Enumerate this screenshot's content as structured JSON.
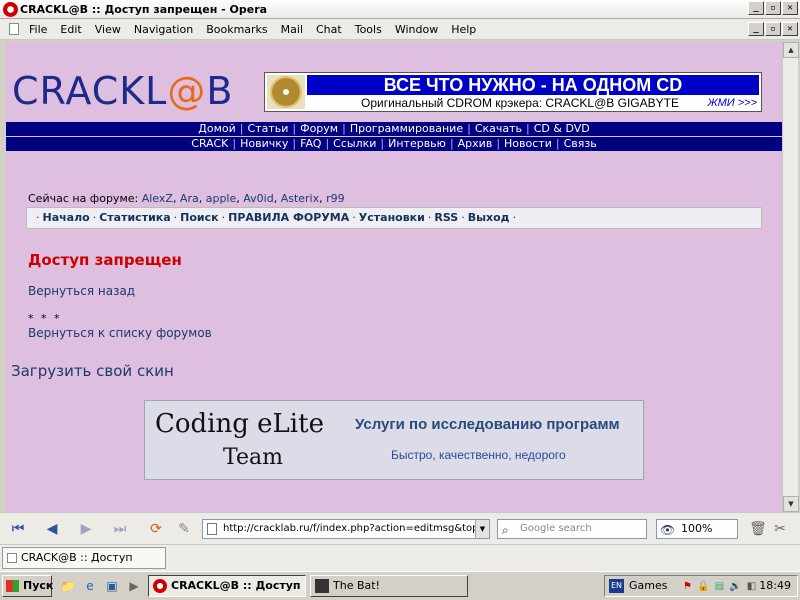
{
  "window": {
    "title": "CRACKL@B :: Доступ запрещен - Opera",
    "controls": [
      "_",
      "▫",
      "✕"
    ]
  },
  "menubar": {
    "items": [
      "File",
      "Edit",
      "View",
      "Navigation",
      "Bookmarks",
      "Mail",
      "Chat",
      "Tools",
      "Window",
      "Help"
    ]
  },
  "site": {
    "logo_text": "CRACKL",
    "logo_at": "@",
    "logo_tail": "B",
    "banner": {
      "headline": "ВСЕ ЧТО НУЖНО - НА ОДНОМ CD",
      "subline": "Оригинальный CDROM крэкера: CRACKL@B GIGABYTE",
      "cta": "ЖМИ >>>"
    },
    "nav1": [
      "Домой",
      "Статьи",
      "Форум",
      "Программирование",
      "Скачать",
      "CD & DVD"
    ],
    "nav2": [
      "CRACK",
      "Новичку",
      "FAQ",
      "Ссылки",
      "Интервью",
      "Архив",
      "Новости",
      "Связь"
    ],
    "online_label": "Сейчас на форуме:",
    "online_users": [
      "AlexZ",
      "Ara",
      "apple",
      "Av0id",
      "Asterix",
      "r99"
    ],
    "forum_menu": [
      "Начало",
      "Статистика",
      "Поиск",
      "ПРАВИЛА ФОРУМА",
      "Установки",
      "RSS",
      "Выход"
    ],
    "error_title": "Доступ запрещен",
    "back_link": "Вернуться назад",
    "stars": "* * *",
    "forums_link": "Вернуться к списку форумов",
    "skin_link": "Загрузить свой скин",
    "ad": {
      "line1": "Coding eLite",
      "line2": "Team",
      "service": "Услуги по исследованию программ",
      "tagline": "Быстро, качественно, недорого"
    }
  },
  "toolbar": {
    "address": "http://cracklab.ru/f/index.php?action=editmsg&top",
    "search_placeholder": "Google search",
    "zoom": "100%"
  },
  "tab": {
    "label": "CRACK@B :: Доступ запр..."
  },
  "taskbar": {
    "start": "Пуск",
    "tasks": [
      {
        "label": "CRACKL@B :: Доступ ...",
        "active": true
      },
      {
        "label": "The Bat!",
        "active": false
      }
    ],
    "lang": "EN",
    "games": "Games",
    "clock": "18:49"
  },
  "colors": {
    "page_bg": "#dfbfdf",
    "nav_bg": "#000080",
    "error": "#cc0000",
    "logo": "#1c2a8c"
  }
}
